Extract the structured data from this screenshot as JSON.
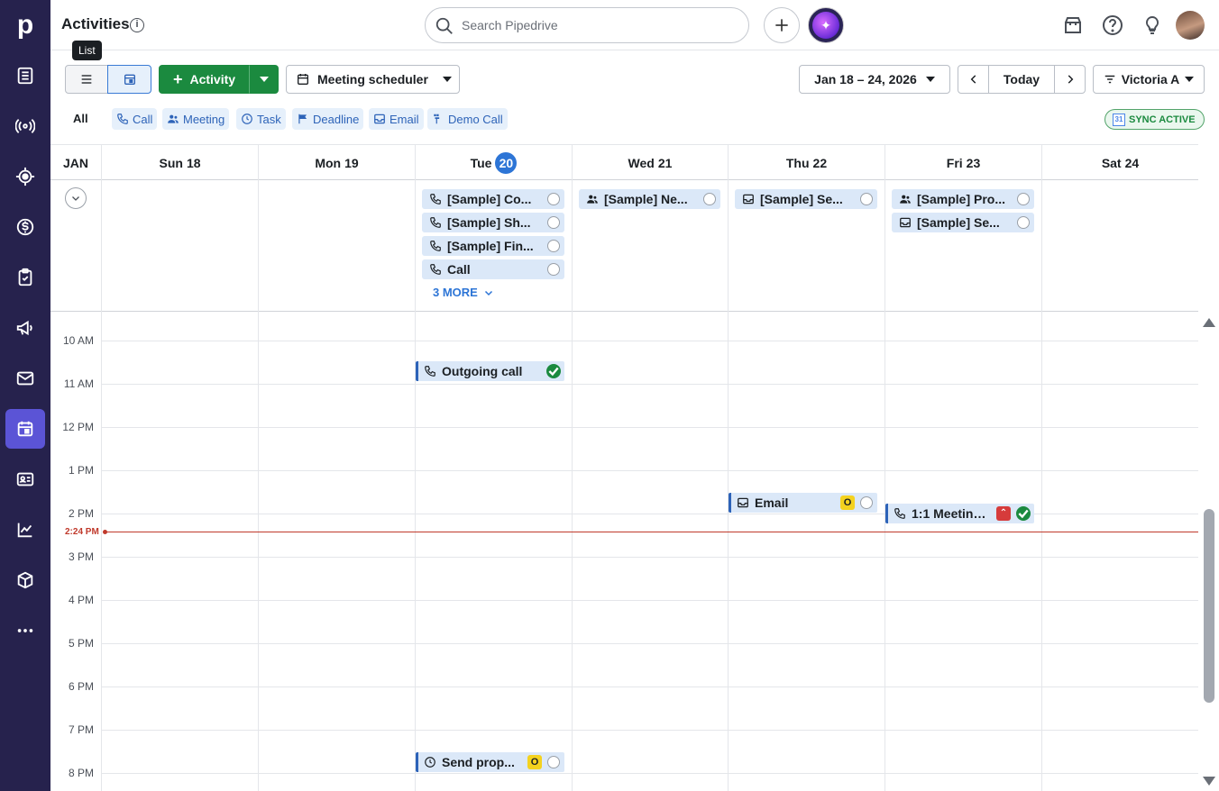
{
  "app": {
    "title": "Activities",
    "tooltip": "List"
  },
  "search": {
    "placeholder": "Search Pipedrive"
  },
  "toolbar": {
    "add_activity_label": "Activity",
    "meeting_scheduler_label": "Meeting scheduler",
    "date_range": "Jan 18 – 24, 2026",
    "today_label": "Today",
    "user_filter": "Victoria A"
  },
  "filters": {
    "all": "All",
    "types": [
      "Call",
      "Meeting",
      "Task",
      "Deadline",
      "Email",
      "Demo Call"
    ]
  },
  "sync_status": "SYNC ACTIVE",
  "calendar": {
    "month": "JAN",
    "days": [
      {
        "name": "Sun",
        "num": "18"
      },
      {
        "name": "Mon",
        "num": "19"
      },
      {
        "name": "Tue",
        "num": "20"
      },
      {
        "name": "Wed",
        "num": "21"
      },
      {
        "name": "Thu",
        "num": "22"
      },
      {
        "name": "Fri",
        "num": "23"
      },
      {
        "name": "Sat",
        "num": "24"
      }
    ],
    "today_index": 2,
    "hours": [
      "10 AM",
      "11 AM",
      "12 PM",
      "1 PM",
      "2 PM",
      "3 PM",
      "4 PM",
      "5 PM",
      "6 PM",
      "7 PM",
      "8 PM"
    ],
    "now_label": "2:24 PM",
    "all_day": {
      "tue": [
        "[Sample] Co...",
        "[Sample] Sh...",
        "[Sample] Fin...",
        "Call"
      ],
      "tue_more": "3 MORE",
      "wed": [
        "[Sample] Ne..."
      ],
      "thu": [
        "[Sample] Se..."
      ],
      "fri": [
        "[Sample] Pro...",
        "[Sample] Se..."
      ]
    },
    "timed": {
      "outgoing_call": "Outgoing call",
      "email": "Email",
      "meeting": "1:1 Meeting...",
      "send_proposal": "Send prop..."
    }
  },
  "colors": {
    "nav_bg": "#26224d",
    "accent_green": "#1b8a3f",
    "accent_blue": "#2d75d6",
    "now_line": "#c0392b"
  }
}
